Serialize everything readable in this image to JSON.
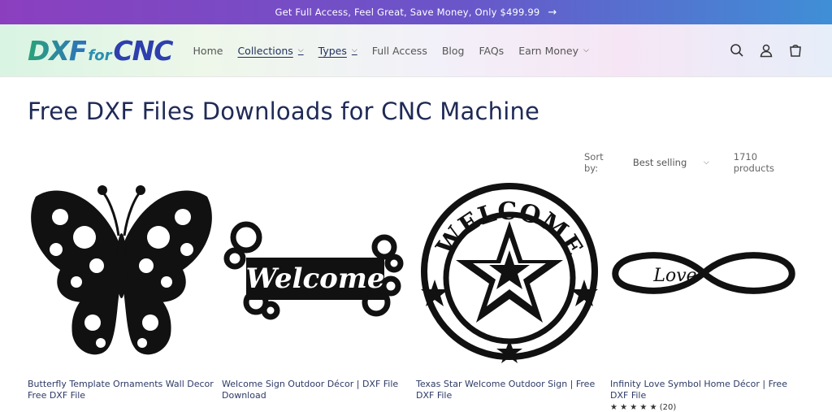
{
  "announcement": {
    "text": "Get Full Access, Feel Great, Save Money, Only $499.99",
    "arrow": "→"
  },
  "logo": {
    "part1": "DXF",
    "part2": "for",
    "part3": "CNC"
  },
  "nav": [
    {
      "label": "Home"
    },
    {
      "label": "Collections"
    },
    {
      "label": "Types"
    },
    {
      "label": "Full Access"
    },
    {
      "label": "Blog"
    },
    {
      "label": "FAQs"
    },
    {
      "label": "Earn Money"
    }
  ],
  "header_icons": [
    "search-icon",
    "account-icon",
    "cart-icon"
  ],
  "page": {
    "title": "Free DXF Files Downloads for CNC Machine"
  },
  "sort": {
    "label": "Sort by:",
    "value": "Best selling",
    "count": "1710 products"
  },
  "products": [
    {
      "title": "Butterfly Template Ornaments Wall Decor Free DXF File",
      "image": "butterfly"
    },
    {
      "title": "Welcome Sign Outdoor Décor | DXF File Download",
      "image": "welcome-sign",
      "image_text": "Welcome"
    },
    {
      "title": "Texas Star Welcome Outdoor Sign | Free DXF File",
      "image": "texas-star",
      "image_text": "WELCOME"
    },
    {
      "title": "Infinity Love Symbol Home Décor | Free DXF File",
      "image": "infinity-love",
      "image_text": "Love",
      "rating_stars": "★ ★ ★ ★ ★",
      "rating_count": "(20)"
    }
  ]
}
